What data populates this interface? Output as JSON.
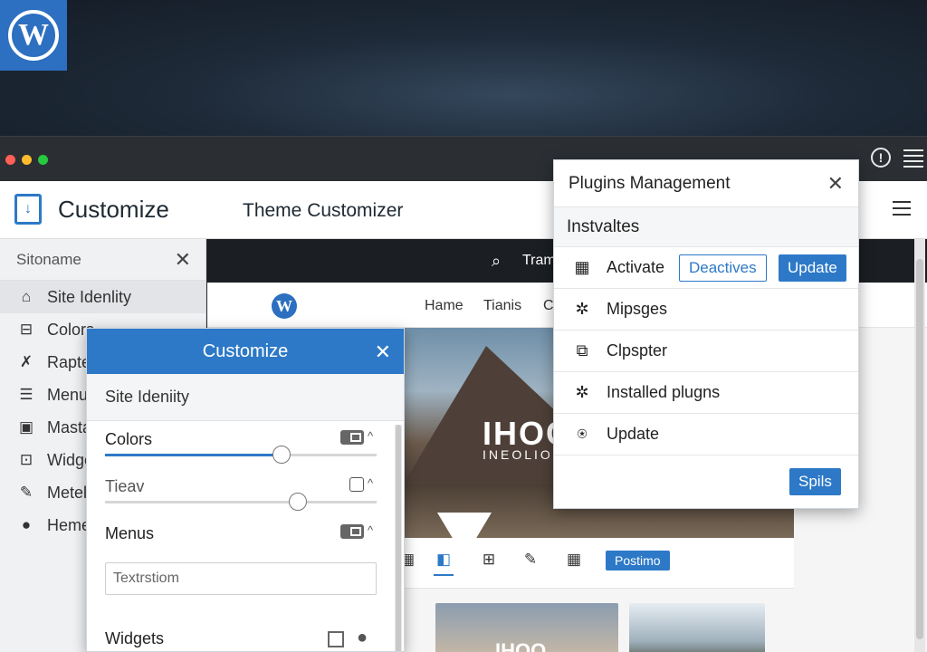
{
  "window": {
    "title": "Customize",
    "subtitle": "Theme Customizer",
    "wp_logo": "W"
  },
  "colors": {
    "accent": "#2d79c7",
    "topbar": "#2b2f33",
    "dot_red": "#ff5f56",
    "dot_yellow": "#ffbd2e",
    "dot_green": "#27c93f"
  },
  "sidebar": {
    "header": "Sitoname",
    "items": [
      {
        "label": "Site Idenlity",
        "icon": "store-icon",
        "glyph": "⌂"
      },
      {
        "label": "Colors",
        "icon": "lock-icon",
        "glyph": "🔒"
      },
      {
        "label": "Rapte",
        "icon": "tool-icon",
        "glyph": "✗"
      },
      {
        "label": "Menu",
        "icon": "menu-icon",
        "glyph": "☰"
      },
      {
        "label": "Masta",
        "icon": "image-icon",
        "glyph": "▣"
      },
      {
        "label": "Widge",
        "icon": "widget-icon",
        "glyph": "⊡"
      },
      {
        "label": "Metel",
        "icon": "edit-icon",
        "glyph": "✎"
      },
      {
        "label": "Heme",
        "icon": "users-icon",
        "glyph": "●"
      }
    ]
  },
  "site": {
    "search_text": "Tram",
    "nav": [
      "Hame",
      "Tianis",
      "C"
    ],
    "hero_title": "IHOC",
    "hero_subtitle": "INEOLIOM",
    "toolbar_button": "Postimo",
    "thumb_text": "IHOO"
  },
  "customize_panel": {
    "title": "Customize",
    "section": "Site Ideniity",
    "rows": [
      {
        "label": "Colors",
        "value": 0.65
      },
      {
        "label": "Tieav",
        "value": 0.71
      },
      {
        "label": "Menus"
      }
    ],
    "input_value": "Textrstiom",
    "widgets_label": "Widgets"
  },
  "plugins_panel": {
    "title": "Plugins Management",
    "section": "Instvaltes",
    "rows": [
      {
        "label": "Activate",
        "icon": "grid-icon",
        "glyph": "▦"
      },
      {
        "label": "Mipsges",
        "icon": "gear-icon",
        "glyph": "✲"
      },
      {
        "label": "Clpspter",
        "icon": "copy-icon",
        "glyph": "⧉"
      },
      {
        "label": "Installed plugns",
        "icon": "cog-icon",
        "glyph": "✲"
      },
      {
        "label": "Update",
        "icon": "award-icon",
        "glyph": "⍟"
      }
    ],
    "btn_deactivate": "Deactives",
    "btn_update": "Update",
    "footer_button": "Spils"
  }
}
